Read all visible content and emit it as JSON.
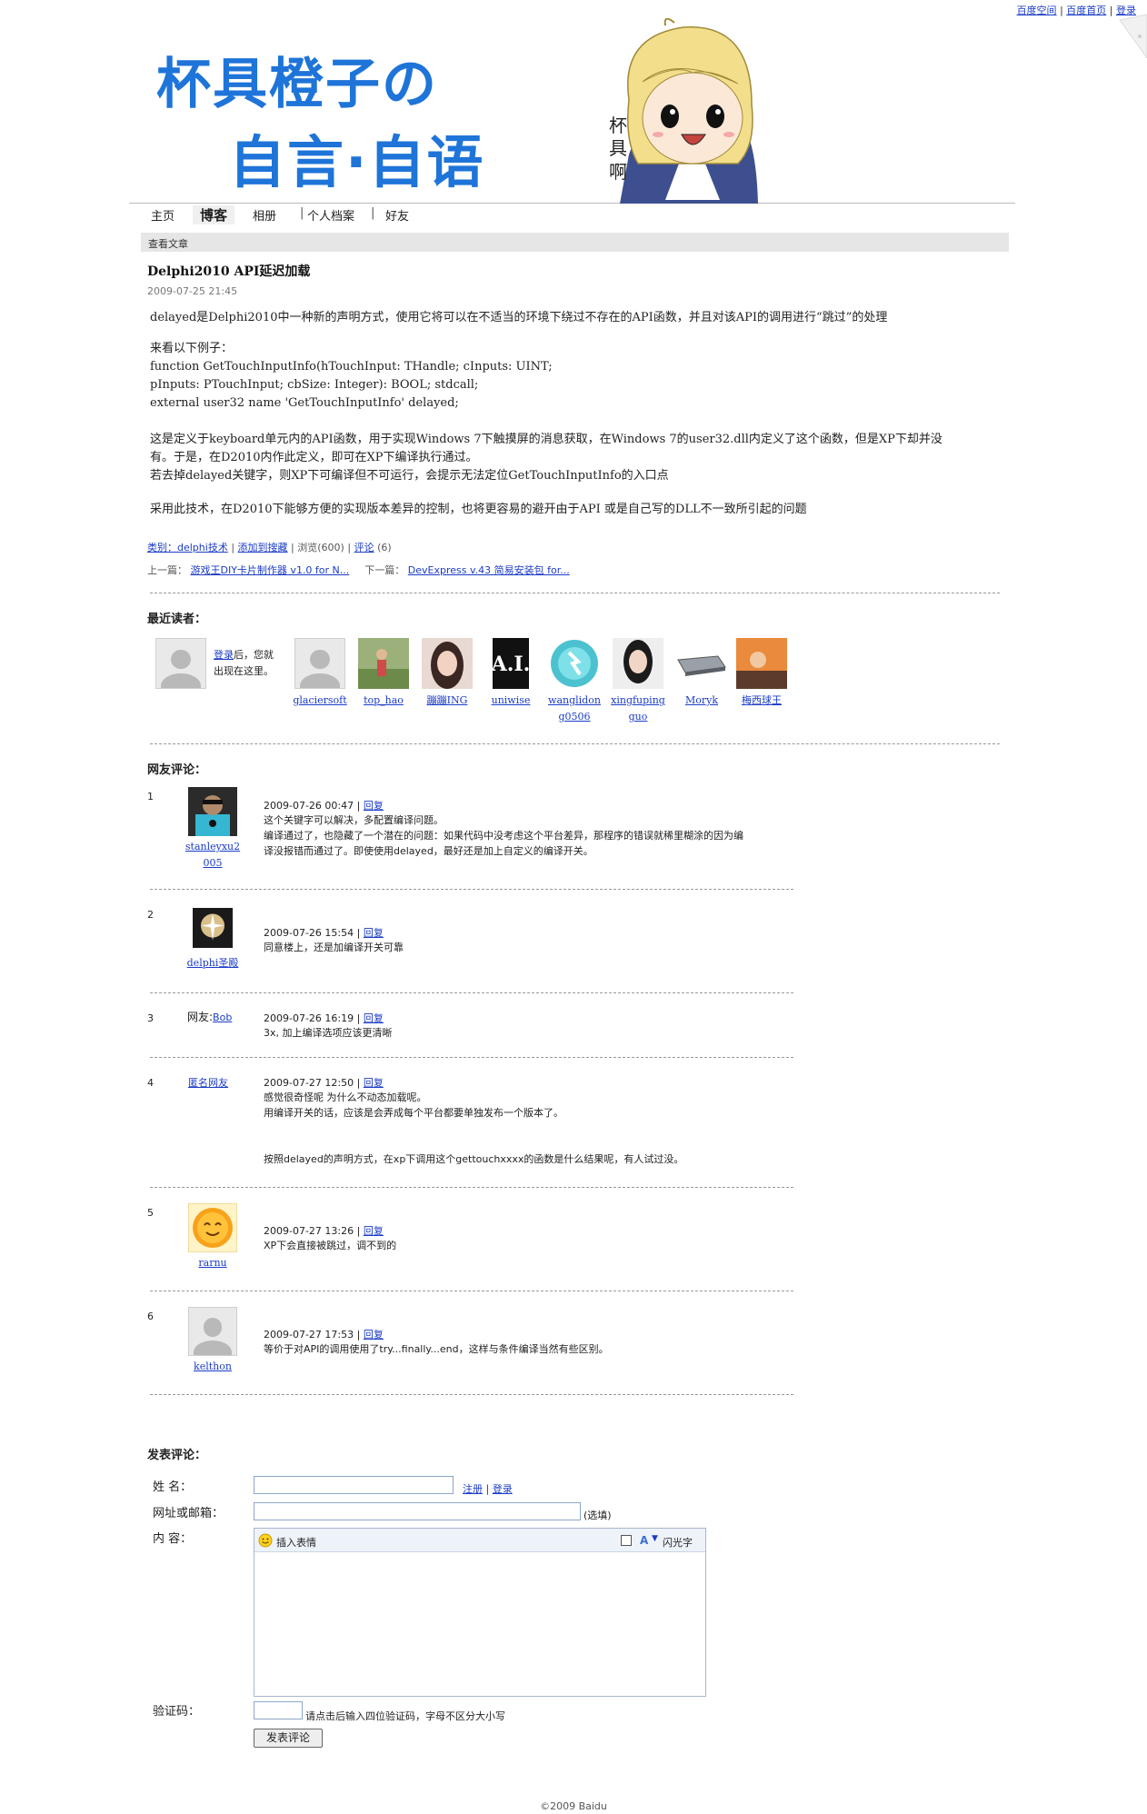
{
  "toplinks": {
    "space": "百度空间",
    "sep1": "|",
    "home": "百度首页",
    "sep2": "|",
    "login": "登录"
  },
  "header": {
    "title_line1": "杯具橙子の",
    "title_line2": "自言·自语",
    "mascot_text": [
      "杯",
      "具",
      "啊"
    ]
  },
  "nav": {
    "items": [
      "主页",
      "博客",
      "相册",
      "个人档案",
      "好友"
    ],
    "active": "博客",
    "sep": "|"
  },
  "section_label": "查看文章",
  "post": {
    "title": "Delphi2010 API延迟加载",
    "date": "2009-07-25 21:45",
    "para1": "delayed是Delphi2010中一种新的声明方式，使用它将可以在不适当的环境下绕过不存在的API函数，并且对该API的调用进行“跳过”的处理",
    "para2": [
      "来看以下例子：",
      "function GetTouchInputInfo(hTouchInput: THandle; cInputs: UINT;",
      "pInputs: PTouchInput; cbSize: Integer): BOOL; stdcall;",
      "external user32 name 'GetTouchInputInfo' delayed;"
    ],
    "para3": [
      "这是定义于keyboard单元内的API函数，用于实现Windows 7下触摸屏的消息获取，在Windows 7的user32.dll内定义了这个函数，但是XP下却并没",
      "有。于是，在D2010内作此定义，即可在XP下编译执行通过。",
      "若去掉delayed关键字，则XP下可编译但不可运行，会提示无法定位GetTouchInputInfo的入口点"
    ],
    "para4": "采用此技术，在D2010下能够方便的实现版本差异的控制，也将更容易的避开由于API 或是自己写的DLL不一致所引起的问题",
    "meta": {
      "category": "类别：delphi技术",
      "sep1": "|",
      "add_search": "添加到搜藏",
      "sep2": "|",
      "views": "浏览(600)",
      "sep3": "|",
      "comments_link": "评论",
      "comments_count": "(6)"
    },
    "prev_label": "上一篇：",
    "prev_link": "游戏王DIY卡片制作器  v1.0 for N...",
    "next_label": "下一篇：",
    "next_link": "DevExpress v.43 简易安装包  for..."
  },
  "readers": {
    "heading": "最近读者：",
    "login_link": "登录",
    "login_suffix": "后，您就",
    "login_line2": "出现在这里。",
    "list": [
      {
        "name_line1": "glaciersoft",
        "name_line2": "",
        "icon": "default-avatar-icon"
      },
      {
        "name_line1": "top_hao",
        "name_line2": "",
        "icon": "photo-avatar-icon"
      },
      {
        "name_line1": "蹦蹦ING",
        "name_line2": "",
        "icon": "photo-avatar-icon"
      },
      {
        "name_line1": "uniwise",
        "name_line2": "",
        "icon": "ai-logo-icon"
      },
      {
        "name_line1": "wanglidon",
        "name_line2": "g0506",
        "icon": "globe-avatar-icon"
      },
      {
        "name_line1": "xingfuping",
        "name_line2": "guo",
        "icon": "photo-avatar-icon"
      },
      {
        "name_line1": "Moryk",
        "name_line2": "",
        "icon": "device-avatar-icon"
      },
      {
        "name_line1": "梅西球王",
        "name_line2": "",
        "icon": "photo-avatar-icon"
      }
    ]
  },
  "comments": {
    "heading": "网友评论：",
    "reply_label": "回复",
    "sep": "|",
    "items": [
      {
        "num": "1",
        "user": "stanleyxu2005",
        "user_line1": "stanleyxu2",
        "user_line2": "005",
        "date": "2009-07-26 00:47",
        "lines": [
          "这个关键字可以解决，多配置编译问题。",
          "编译通过了，也隐藏了一个潜在的问题：如果代码中没考虑这个平台差异，那程序的错误就稀里糊涂的因为编",
          "译没报错而通过了。即使使用delayed，最好还是加上自定义的编译开关。"
        ]
      },
      {
        "num": "2",
        "user": "delphi圣殿",
        "user_line1": "delphi圣殿",
        "user_line2": "",
        "date": "2009-07-26 15:54",
        "lines": [
          "同意楼上，还是加编译开关可靠"
        ]
      },
      {
        "num": "3",
        "user_prefix": "网友:",
        "user": "Bob",
        "date": "2009-07-26 16:19",
        "lines": [
          "3x, 加上编译选项应该更清晰"
        ]
      },
      {
        "num": "4",
        "user": "匿名网友",
        "date": "2009-07-27 12:50",
        "lines": [
          "感觉很奇怪呢  为什么不动态加载呢。",
          "用编译开关的话，应该是会弄成每个平台都要单独发布一个版本了。",
          "",
          "",
          "按照delayed的声明方式，在xp下调用这个gettouchxxxx的函数是什么结果呢，有人试过没。"
        ]
      },
      {
        "num": "5",
        "user": "rarnu",
        "user_line1": "rarnu",
        "user_line2": "",
        "date": "2009-07-27 13:26",
        "lines": [
          "XP下会直接被跳过，调不到的"
        ]
      },
      {
        "num": "6",
        "user": "kelthon",
        "user_line1": "kelthon",
        "user_line2": "",
        "date": "2009-07-27 17:53",
        "lines": [
          "等价于对API的调用使用了try...finally...end，这样与条件编译当然有些区别。"
        ]
      }
    ]
  },
  "form": {
    "heading": "发表评论：",
    "name_label": "姓    名：",
    "name_value": "",
    "register_link": "注册",
    "sep": "|",
    "login_link": "登录",
    "url_label": "网址或邮箱：",
    "url_value": "",
    "optional": "(选填)",
    "content_label": "内    容：",
    "emoji_label": "插入表情",
    "flash_label": "闪光字",
    "captcha_label": "验证码：",
    "captcha_value": "",
    "captcha_hint": "请点击后输入四位验证码，字母不区分大小写",
    "submit": "发表评论"
  },
  "footer": "©2009 Baidu",
  "colors": {
    "accent": "#1e74d8",
    "link": "#1a3bc6"
  }
}
